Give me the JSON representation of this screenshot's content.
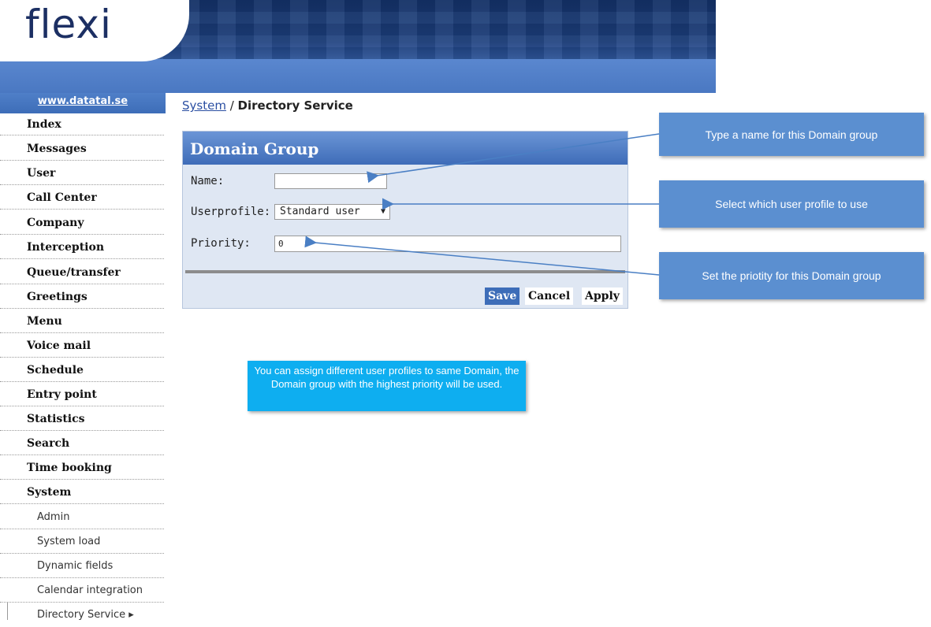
{
  "header": {
    "logo_text": "flexi"
  },
  "sidebar": {
    "site_link": "www.datatal.se",
    "items": [
      {
        "label": "Index"
      },
      {
        "label": "Messages"
      },
      {
        "label": "User"
      },
      {
        "label": "Call Center"
      },
      {
        "label": "Company"
      },
      {
        "label": "Interception"
      },
      {
        "label": "Queue/transfer"
      },
      {
        "label": "Greetings"
      },
      {
        "label": "Menu"
      },
      {
        "label": "Voice mail"
      },
      {
        "label": "Schedule"
      },
      {
        "label": "Entry point"
      },
      {
        "label": "Statistics"
      },
      {
        "label": "Search"
      },
      {
        "label": "Time booking"
      },
      {
        "label": "System"
      }
    ],
    "subitems": [
      {
        "label": "Admin"
      },
      {
        "label": "System load"
      },
      {
        "label": "Dynamic fields"
      },
      {
        "label": "Calendar integration"
      },
      {
        "label": "Directory Service ▸"
      }
    ]
  },
  "breadcrumb": {
    "parent": "System",
    "separator": " / ",
    "current": "Directory Service"
  },
  "form": {
    "title": "Domain Group",
    "name_label": "Name:",
    "name_value": "",
    "userprofile_label": "Userprofile:",
    "userprofile_value": "Standard user",
    "priority_label": "Priority:",
    "priority_value": "0",
    "save_label": "Save",
    "cancel_label": "Cancel",
    "apply_label": "Apply"
  },
  "callouts": {
    "name_hint": "Type a name for this Domain group",
    "userprofile_hint": "Select which user profile to use",
    "priority_hint": "Set the priotity for this Domain group",
    "info_note": "You can assign different user profiles to same Domain, the Domain group with the highest priority will be used."
  },
  "colors": {
    "header_dark": "#14336b",
    "accent_blue": "#3d6db8",
    "callout_blue": "#5b8fd0",
    "info_blue": "#0eaef0"
  }
}
